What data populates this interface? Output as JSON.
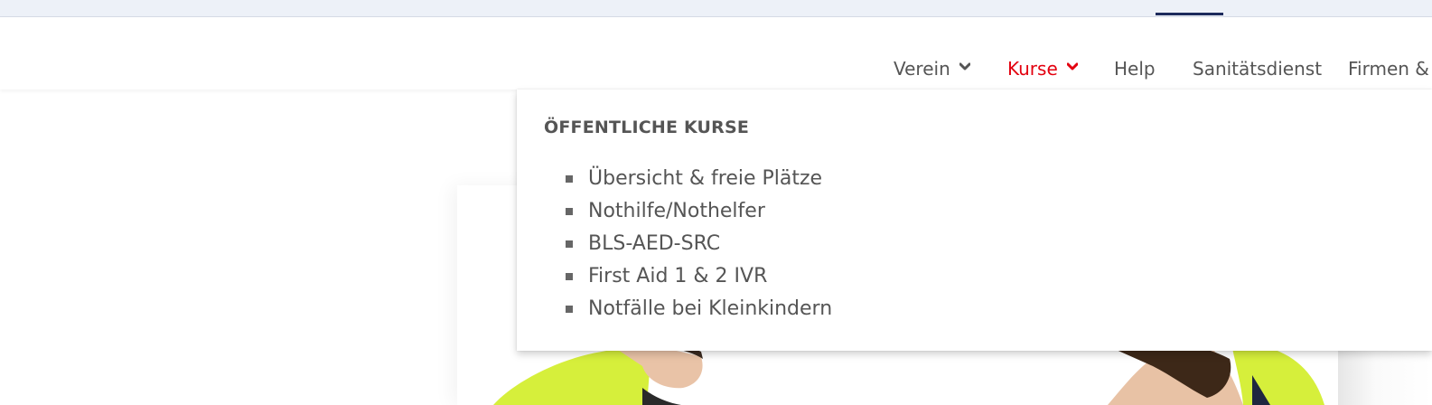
{
  "nav": {
    "items": [
      {
        "label": "Verein",
        "has_dropdown": true,
        "active": false
      },
      {
        "label": "Kurse",
        "has_dropdown": true,
        "active": true
      },
      {
        "label": "Help",
        "has_dropdown": false,
        "active": false
      },
      {
        "label": "Sanitätsdienst",
        "has_dropdown": false,
        "active": false
      },
      {
        "label": "Firmen &",
        "has_dropdown": false,
        "active": false
      }
    ],
    "active_color": "#e3000f",
    "text_color": "#555555"
  },
  "dropdown": {
    "heading": "ÖFFENTLICHE KURSE",
    "items": [
      {
        "label": "Übersicht & freie Plätze"
      },
      {
        "label": "Nothilfe/Nothelfer"
      },
      {
        "label": "BLS-AED-SRC"
      },
      {
        "label": "First Aid 1 & 2 IVR"
      },
      {
        "label": "Notfälle bei Kleinkindern"
      }
    ]
  },
  "icons": {
    "dropdown_chevron": "chevron-down-icon",
    "list_bullet": "square-bullet-icon"
  },
  "colors": {
    "top_strip": "#edf1f8",
    "top_indicator": "#1d2a5c",
    "jacket_yellow": "#d9f23a"
  }
}
